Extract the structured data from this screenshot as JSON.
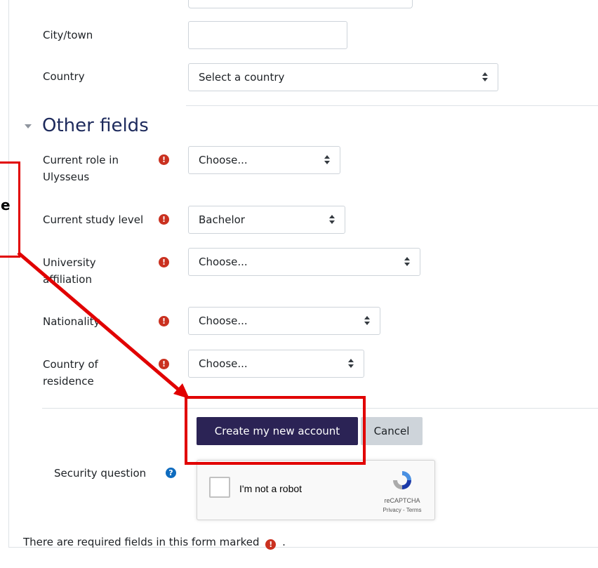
{
  "location": {
    "city_label": "City/town",
    "city_value": "",
    "country_label": "Country",
    "country_value": "Select a country"
  },
  "other_fields": {
    "title": "Other fields",
    "role": {
      "label_line1": "Current role in",
      "label_line2": "Ulysseus",
      "value": "Choose..."
    },
    "study_level": {
      "label": "Current study level",
      "value": "Bachelor"
    },
    "university": {
      "label_line1": "University",
      "label_line2": "affiliation",
      "value": "Choose..."
    },
    "nationality": {
      "label": "Nationality",
      "value": "Choose..."
    },
    "residence": {
      "label_line1": "Country of",
      "label_line2": "residence",
      "value": "Choose..."
    },
    "required_icon": "exclamation-circle-icon",
    "required_glyph": "!"
  },
  "actions": {
    "submit_label": "Create my new account",
    "cancel_label": "Cancel"
  },
  "security": {
    "label": "Security question",
    "help_glyph": "?",
    "captcha_label": "I'm not a robot",
    "captcha_brand": "reCAPTCHA",
    "captcha_links": "Privacy - Terms"
  },
  "footer": {
    "required_note_prefix": "There are required fields in this form marked",
    "required_note_suffix": "."
  },
  "annotation": {
    "callout_text": "e",
    "color": "#e10000"
  },
  "colors": {
    "primary_button": "#2b2355",
    "heading": "#1d2a5c",
    "required": "#ca3120",
    "help": "#0f6cbf"
  }
}
